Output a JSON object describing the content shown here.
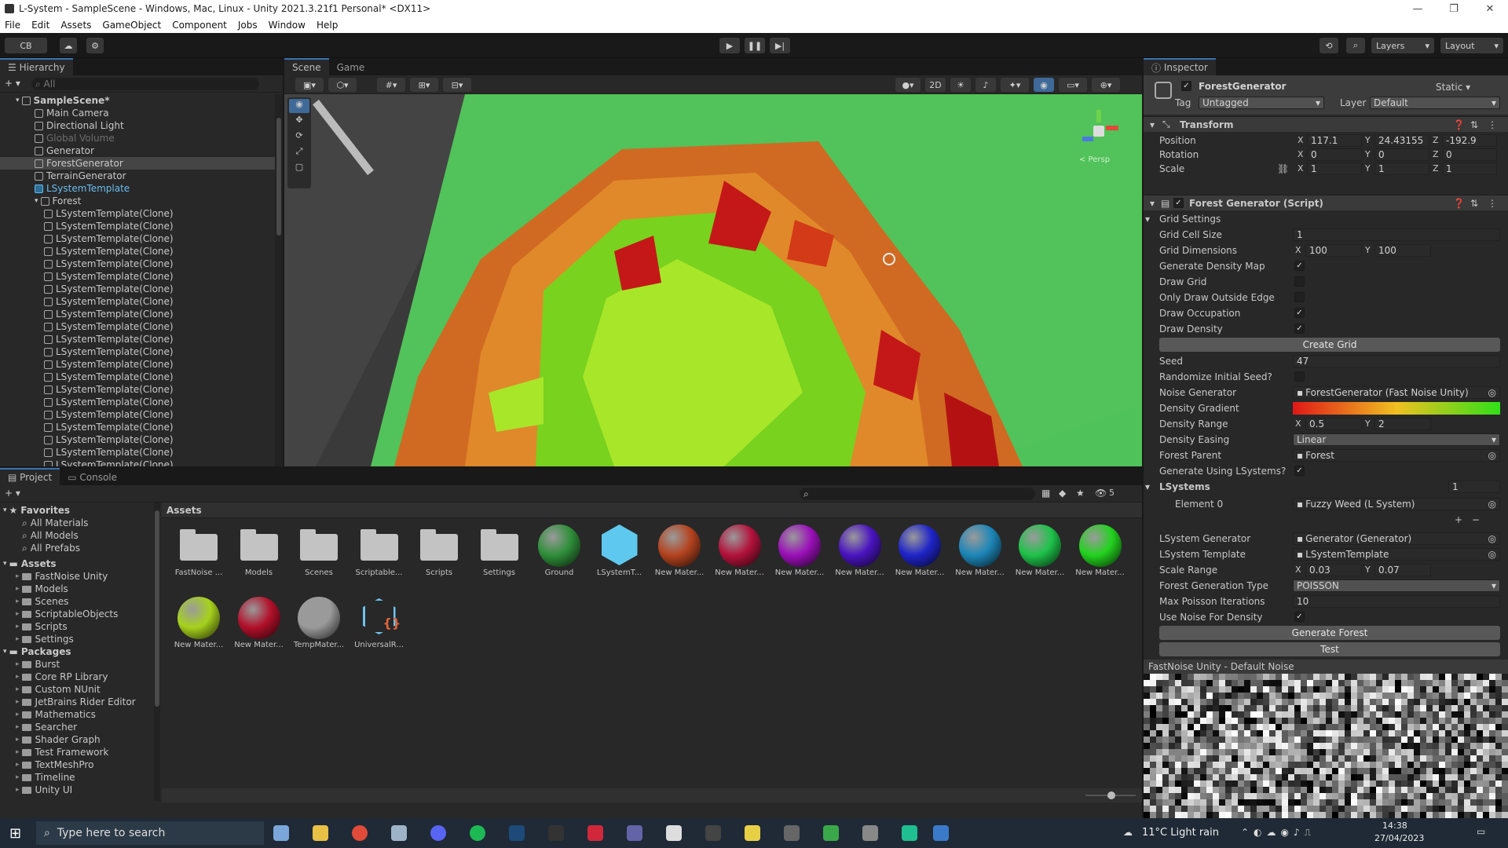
{
  "window": {
    "title": "L-System - SampleScene - Windows, Mac, Linux - Unity 2021.3.21f1 Personal* <DX11>"
  },
  "menu": [
    "File",
    "Edit",
    "Assets",
    "GameObject",
    "Component",
    "Jobs",
    "Window",
    "Help"
  ],
  "toolbar": {
    "account": "CB",
    "layers": "Layers",
    "layout": "Layout"
  },
  "hierarchy": {
    "tab": "Hierarchy",
    "search_placeholder": "All",
    "rows": [
      "SampleScene*",
      "Main Camera",
      "Directional Light",
      "Global Volume",
      "Generator",
      "ForestGenerator",
      "TerrainGenerator",
      "LSystemTemplate",
      "Forest",
      "LSystemTemplate(Clone)",
      "LSystemTemplate(Clone)",
      "LSystemTemplate(Clone)",
      "LSystemTemplate(Clone)",
      "LSystemTemplate(Clone)",
      "LSystemTemplate(Clone)",
      "LSystemTemplate(Clone)",
      "LSystemTemplate(Clone)",
      "LSystemTemplate(Clone)",
      "LSystemTemplate(Clone)",
      "LSystemTemplate(Clone)",
      "LSystemTemplate(Clone)",
      "LSystemTemplate(Clone)",
      "LSystemTemplate(Clone)",
      "LSystemTemplate(Clone)",
      "LSystemTemplate(Clone)",
      "LSystemTemplate(Clone)",
      "LSystemTemplate(Clone)",
      "LSystemTemplate(Clone)",
      "LSystemTemplate(Clone)",
      "LSystemTemplate(Clone)"
    ]
  },
  "scene": {
    "tab_scene": "Scene",
    "tab_game": "Game",
    "mode_2d": "2D",
    "persp": "< Persp"
  },
  "inspector": {
    "tab": "Inspector",
    "object_name": "ForestGenerator",
    "static": "Static",
    "tag_label": "Tag",
    "tag": "Untagged",
    "layer_label": "Layer",
    "layer": "Default",
    "transform": {
      "header": "Transform",
      "position": {
        "label": "Position",
        "x": "117.1",
        "y": "24.43155",
        "z": "-192.9"
      },
      "rotation": {
        "label": "Rotation",
        "x": "0",
        "y": "0",
        "z": "0"
      },
      "scale": {
        "label": "Scale",
        "x": "1",
        "y": "1",
        "z": "1"
      }
    },
    "script": {
      "header": "Forest Generator (Script)",
      "grid_settings": "Grid Settings",
      "grid_cell_size_label": "Grid Cell Size",
      "grid_cell_size": "1",
      "grid_dim_label": "Grid Dimensions",
      "grid_dim_x": "100",
      "grid_dim_y": "100",
      "gen_density_map": "Generate Density Map",
      "draw_grid": "Draw Grid",
      "only_draw_outside": "Only Draw Outside Edge",
      "draw_occupation": "Draw Occupation",
      "draw_density": "Draw Density",
      "create_grid": "Create Grid",
      "seed_label": "Seed",
      "seed": "47",
      "randomize": "Randomize Initial Seed?",
      "noise_gen_label": "Noise Generator",
      "noise_gen": "ForestGenerator (Fast Noise Unity)",
      "density_gradient": "Density Gradient",
      "density_range_label": "Density Range",
      "density_range_x": "0.5",
      "density_range_y": "2",
      "density_easing_label": "Density Easing",
      "density_easing": "Linear",
      "forest_parent_label": "Forest Parent",
      "forest_parent": "Forest",
      "gen_using_lsystems": "Generate Using LSystems?",
      "lsystems_label": "LSystems",
      "lsystems_count": "1",
      "element0_label": "Element 0",
      "element0": "Fuzzy Weed (L System)",
      "lsys_gen_label": "LSystem Generator",
      "lsys_gen": "Generator (Generator)",
      "lsys_template_label": "LSystem Template",
      "lsys_template": "LSystemTemplate",
      "scale_range_label": "Scale Range",
      "scale_range_x": "0.03",
      "scale_range_y": "0.07",
      "forest_gen_type_label": "Forest Generation Type",
      "forest_gen_type": "POISSON",
      "max_poisson_label": "Max Poisson Iterations",
      "max_poisson": "10",
      "use_noise": "Use Noise For Density",
      "generate_forest": "Generate Forest",
      "test": "Test"
    },
    "preview_title": "FastNoise Unity - Default Noise"
  },
  "project": {
    "tab_project": "Project",
    "tab_console": "Console",
    "assets_header": "Assets",
    "hidden_count": "5",
    "favorites": {
      "label": "Favorites",
      "items": [
        "All Materials",
        "All Models",
        "All Prefabs"
      ]
    },
    "assets_tree": {
      "label": "Assets",
      "items": [
        "FastNoise Unity",
        "Models",
        "Scenes",
        "ScriptableObjects",
        "Scripts",
        "Settings"
      ]
    },
    "packages": {
      "label": "Packages",
      "items": [
        "Burst",
        "Core RP Library",
        "Custom NUnit",
        "JetBrains Rider Editor",
        "Mathematics",
        "Searcher",
        "Shader Graph",
        "Test Framework",
        "TextMeshPro",
        "Timeline",
        "Unity UI"
      ]
    },
    "grid": [
      {
        "name": "FastNoise ...",
        "kind": "folder"
      },
      {
        "name": "Models",
        "kind": "folder"
      },
      {
        "name": "Scenes",
        "kind": "folder"
      },
      {
        "name": "Scriptable...",
        "kind": "folder"
      },
      {
        "name": "Scripts",
        "kind": "folder"
      },
      {
        "name": "Settings",
        "kind": "folder"
      },
      {
        "name": "Ground",
        "kind": "sphere",
        "color": "#2f8f3a"
      },
      {
        "name": "LSystemT...",
        "kind": "prefab",
        "color": "#5fc8ee"
      },
      {
        "name": "New Mater...",
        "kind": "sphere",
        "color": "#b4431f"
      },
      {
        "name": "New Mater...",
        "kind": "sphere",
        "color": "#b3123c"
      },
      {
        "name": "New Mater...",
        "kind": "sphere",
        "color": "#9a10b8"
      },
      {
        "name": "New Mater...",
        "kind": "sphere",
        "color": "#4a14c0"
      },
      {
        "name": "New Mater...",
        "kind": "sphere",
        "color": "#1f24c8"
      },
      {
        "name": "New Mater...",
        "kind": "sphere",
        "color": "#1d86b8"
      },
      {
        "name": "New Mater...",
        "kind": "sphere",
        "color": "#1fc24a"
      },
      {
        "name": "New Mater...",
        "kind": "sphere",
        "color": "#23d21f"
      },
      {
        "name": "New Mater...",
        "kind": "sphere",
        "color": "#a6d21c"
      },
      {
        "name": "New Mater...",
        "kind": "sphere",
        "color": "#b2102a"
      },
      {
        "name": "TempMater...",
        "kind": "sphere",
        "color": "#9a9a9a"
      },
      {
        "name": "UniversalR...",
        "kind": "asset",
        "color": "#6cc4ee"
      }
    ]
  },
  "taskbar": {
    "search_placeholder": "Type here to search",
    "weather": "11°C  Light rain",
    "time": "14:38",
    "date": "27/04/2023"
  }
}
